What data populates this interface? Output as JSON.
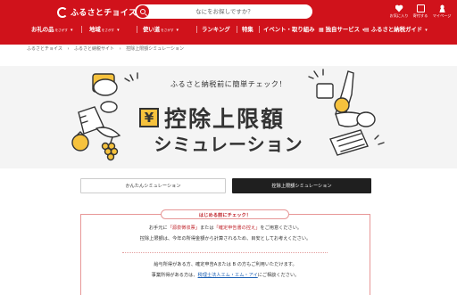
{
  "header": {
    "logo_text": "ふるさとチョイス",
    "search_placeholder": "なにをお探しですか？",
    "icons": [
      {
        "name": "heart-icon",
        "label": "お気に入り"
      },
      {
        "name": "document-icon",
        "label": "寄付する"
      },
      {
        "name": "user-icon",
        "label": "マイページ"
      }
    ],
    "colors": {
      "brand": "#d0121b",
      "accent": "#f6c23d"
    }
  },
  "nav": {
    "items": [
      {
        "label": "お礼の品",
        "sub": "をさがす"
      },
      {
        "label": "地域",
        "sub": "をさがす"
      },
      {
        "label": "使い道",
        "sub": "をさがす"
      },
      {
        "label": "ランキング"
      },
      {
        "label": "特集"
      },
      {
        "label": "イベント・取り組み"
      },
      {
        "label": "独自サービス"
      },
      {
        "label": "ふるさと納税ガイド"
      }
    ]
  },
  "breadcrumb": [
    "ふるさとチョイス",
    "›",
    "ふるさと納税サイト",
    "›",
    "控除上限額シミュレーション"
  ],
  "hero": {
    "tagline": "ふるさと納税前に簡単チェック！",
    "yen_symbol": "¥",
    "title": "控除上限額",
    "subtitle": "シミュレーション"
  },
  "tabs": {
    "simple": "かんたんシミュレーション",
    "detailed": "控除上限額シミュレーション"
  },
  "checklist": {
    "title": "はじめる前にチェック！",
    "line1_pre": "お手元に",
    "line1_b1": "「源泉徴収票」",
    "line1_mid": "または",
    "line1_b2": "「確定申告書の控え」",
    "line1_post": "をご用意ください。",
    "line2": "控除上限額は、今年の所得金額から計算されるため、目安としてお考えください。",
    "line3": "給与所得がある方、確定申告Aまたは B の方もご利用いただけます。",
    "line4_pre": "事業所得がある方は、",
    "line4_link": "税理士法人エム・エム・アイ",
    "line4_post": "にご相談ください。"
  }
}
